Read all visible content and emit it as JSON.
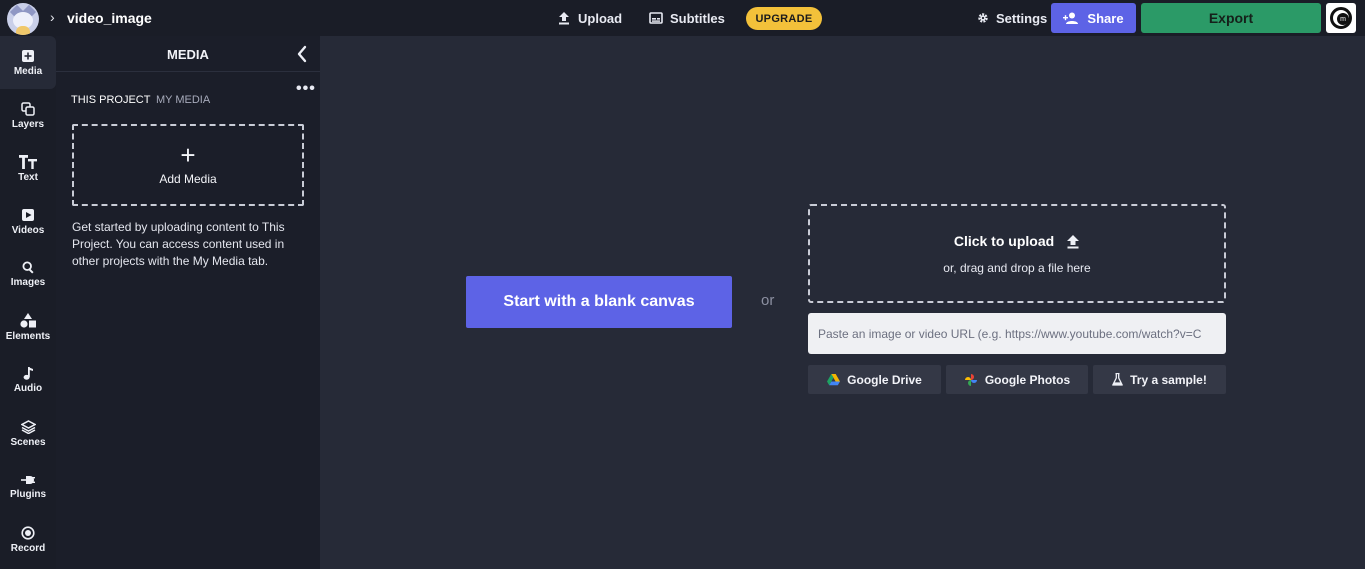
{
  "header": {
    "project_name": "video_image",
    "upload_label": "Upload",
    "subtitles_label": "Subtitles",
    "upgrade_label": "UPGRADE",
    "settings_label": "Settings",
    "share_label": "Share",
    "export_label": "Export"
  },
  "sidebar": {
    "items": [
      {
        "label": "Media",
        "icon": "media-add-icon"
      },
      {
        "label": "Layers",
        "icon": "layers-icon"
      },
      {
        "label": "Text",
        "icon": "text-icon"
      },
      {
        "label": "Videos",
        "icon": "video-icon"
      },
      {
        "label": "Images",
        "icon": "image-search-icon"
      },
      {
        "label": "Elements",
        "icon": "shapes-icon"
      },
      {
        "label": "Audio",
        "icon": "music-note-icon"
      },
      {
        "label": "Scenes",
        "icon": "scenes-stack-icon"
      },
      {
        "label": "Plugins",
        "icon": "plug-icon"
      },
      {
        "label": "Record",
        "icon": "record-icon"
      }
    ],
    "active": "Media"
  },
  "media_panel": {
    "title": "MEDIA",
    "tabs": [
      "THIS PROJECT",
      "MY MEDIA"
    ],
    "active_tab": "THIS PROJECT",
    "add_media_label": "Add Media",
    "help_text": "Get started by uploading content to This Project. You can access content used in other projects with the My Media tab."
  },
  "main": {
    "blank_canvas_label": "Start with a blank canvas",
    "or_label": "or",
    "upload_title": "Click to upload",
    "upload_subtitle": "or, drag and drop a file here",
    "url_placeholder": "Paste an image or video URL (e.g. https://www.youtube.com/watch?v=C",
    "sources": {
      "google_drive": "Google Drive",
      "google_photos": "Google Photos",
      "sample": "Try a sample!"
    }
  },
  "colors": {
    "accent": "#5d63e6",
    "export": "#2b9a67",
    "upgrade": "#f3c13a",
    "background": "#262a37",
    "panel": "#1b1e29"
  }
}
